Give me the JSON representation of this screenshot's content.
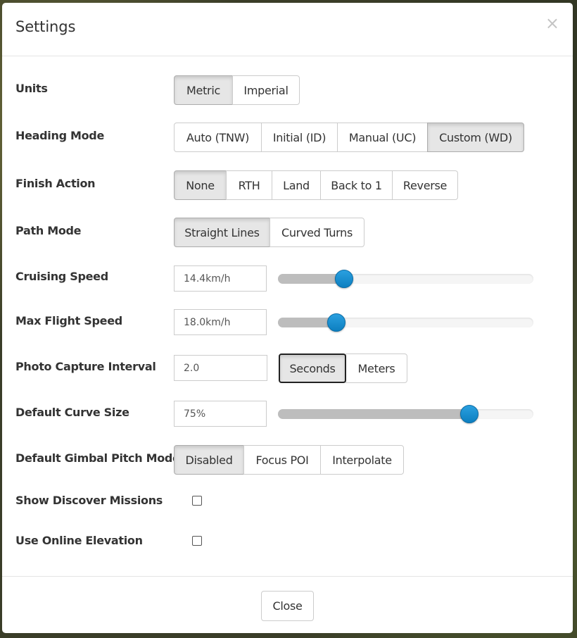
{
  "dialog": {
    "title": "Settings",
    "close_glyph": "×",
    "footer_close_label": "Close"
  },
  "units": {
    "label": "Units",
    "options": [
      "Metric",
      "Imperial"
    ],
    "selected": "Metric"
  },
  "heading_mode": {
    "label": "Heading Mode",
    "options": [
      "Auto (TNW)",
      "Initial (ID)",
      "Manual (UC)",
      "Custom (WD)"
    ],
    "selected": "Custom (WD)"
  },
  "finish_action": {
    "label": "Finish Action",
    "options": [
      "None",
      "RTH",
      "Land",
      "Back to 1",
      "Reverse"
    ],
    "selected": "None"
  },
  "path_mode": {
    "label": "Path Mode",
    "options": [
      "Straight Lines",
      "Curved Turns"
    ],
    "selected": "Straight Lines"
  },
  "cruising_speed": {
    "label": "Cruising Speed",
    "value": "14.4km/h",
    "slider_fraction": 0.26
  },
  "max_flight_speed": {
    "label": "Max Flight Speed",
    "value": "18.0km/h",
    "slider_fraction": 0.23
  },
  "photo_capture_interval": {
    "label": "Photo Capture Interval",
    "value": "2.0",
    "options": [
      "Seconds",
      "Meters"
    ],
    "selected": "Seconds"
  },
  "default_curve_size": {
    "label": "Default Curve Size",
    "value": "75%",
    "slider_fraction": 0.75
  },
  "gimbal_pitch_mode": {
    "label": "Default Gimbal Pitch Mode",
    "options": [
      "Disabled",
      "Focus POI",
      "Interpolate"
    ],
    "selected": "Disabled"
  },
  "show_discover_missions": {
    "label": "Show Discover Missions",
    "checked": false
  },
  "use_online_elevation": {
    "label": "Use Online Elevation",
    "checked": false
  },
  "colors": {
    "slider_handle": "#1a8fd1",
    "active_button_bg": "#e6e6e6"
  }
}
